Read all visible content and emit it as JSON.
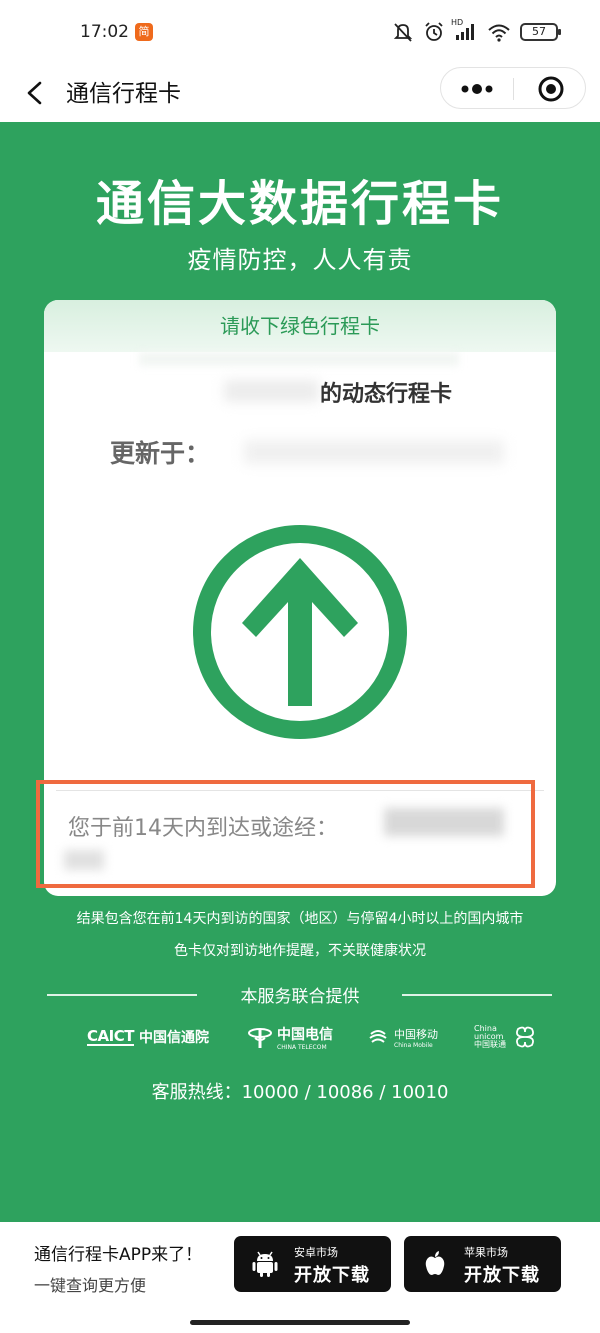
{
  "status_bar": {
    "time": "17:02",
    "app_badge": "简",
    "hd_label": "HD",
    "battery": "57"
  },
  "nav": {
    "title": "通信行程卡"
  },
  "hero": {
    "title": "通信大数据行程卡",
    "subtitle": "疫情防控，人人有责"
  },
  "card": {
    "header": "请收下绿色行程卡",
    "dynamic_label": "的动态行程卡",
    "updated_label": "更新于：",
    "visited_label": "您于前14天内到达或途经：",
    "status_color": "#2ea25e"
  },
  "notes": {
    "line1": "结果包含您在前14天内到访的国家（地区）与停留4小时以上的国内城市",
    "line2": "色卡仅对到访地作提醒，不关联健康状况"
  },
  "services": {
    "title": "本服务联合提供",
    "caict_mark": "CAICT",
    "caict_name": "中国信通院",
    "telecom_name": "中国电信",
    "telecom_en": "CHINA TELECOM",
    "mobile_name": "中国移动",
    "mobile_en": "China Mobile",
    "unicom_name": "China unicom中国联通",
    "hotline": "客服热线：10000 / 10086 / 10010"
  },
  "bottom": {
    "promo_title": "通信行程卡APP来了！",
    "promo_sub": "一键查询更方便",
    "android_small": "安卓市场",
    "android_big": "开放下载",
    "apple_small": "苹果市场",
    "apple_big": "开放下载"
  },
  "icons": {
    "back": "back-arrow-icon",
    "more": "more-dots-icon",
    "target": "close-target-icon",
    "arrow": "up-arrow-circle-icon",
    "android": "android-icon",
    "apple": "apple-icon"
  }
}
